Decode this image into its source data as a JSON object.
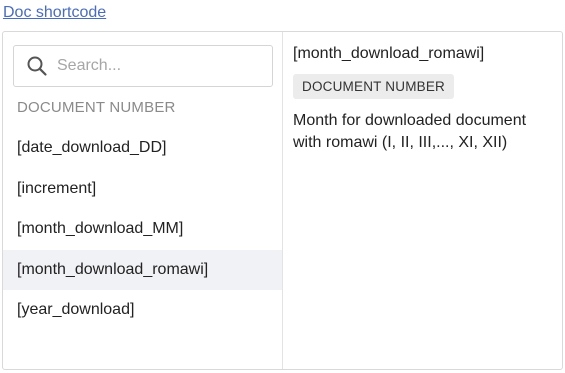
{
  "trigger": {
    "label": "Doc shortcode"
  },
  "search": {
    "placeholder": "Search...",
    "value": ""
  },
  "section": {
    "header": "DOCUMENT NUMBER"
  },
  "items": [
    {
      "label": "[date_download_DD]"
    },
    {
      "label": "[increment]"
    },
    {
      "label": "[month_download_MM]"
    },
    {
      "label": "[month_download_romawi]"
    },
    {
      "label": "[year_download]"
    }
  ],
  "selected_index": 3,
  "detail": {
    "title": "[month_download_romawi]",
    "badge": "DOCUMENT NUMBER",
    "description": "Month for downloaded document with romawi (I, II, III,..., XI, XII)"
  },
  "colors": {
    "link": "#4a6cc0",
    "active_row": "#f1f2f5",
    "badge_bg": "#ececec"
  },
  "icons": {
    "search": "search-icon"
  }
}
